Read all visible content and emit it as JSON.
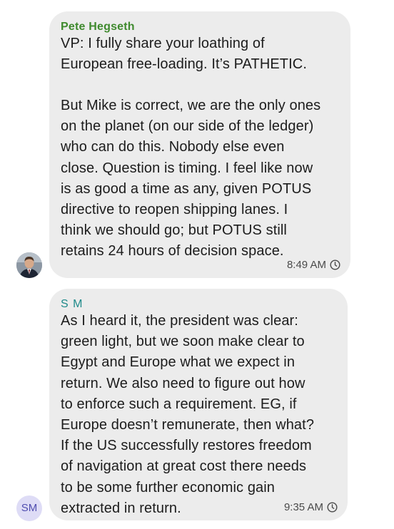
{
  "messages": [
    {
      "sender": "Pete Hegseth",
      "paragraphs": [
        [
          "VP: I fully share your loathing of",
          "European free-loading. It’s PATHETIC."
        ],
        [
          "But Mike is correct, we are the only ones",
          "on the planet (on our side of the ledger)",
          "who can do this. Nobody else even",
          "close. Question is timing. I feel like now",
          "is as good a time as any, given POTUS",
          "directive to reopen shipping lanes. I",
          "think we should go; but POTUS still",
          "retains 24 hours of decision space."
        ]
      ],
      "time": "8:49 AM",
      "avatar": "photo"
    },
    {
      "sender": "S M",
      "paragraphs": [
        [
          "As I heard it, the president was clear:",
          "green light, but we soon make clear to",
          "Egypt and Europe what we expect in",
          "return. We also need to figure out how",
          "to enforce such a requirement. EG, if",
          "Europe doesn’t remunerate, then what?",
          "If the US successfully restores freedom",
          "of navigation at great cost there needs",
          "to be some further economic gain",
          "extracted in return."
        ]
      ],
      "time": "9:35 AM",
      "avatar_initials": "SM"
    }
  ],
  "colors": {
    "bubble": "#ececec",
    "sender_1": "#3f8a2e",
    "sender_2": "#1f8a8a",
    "avatar_initials_bg": "#dedcf6",
    "avatar_initials_text": "#4f4db0"
  },
  "icons": {
    "clock": "clock-icon",
    "avatar_photo": "avatar-photo"
  }
}
